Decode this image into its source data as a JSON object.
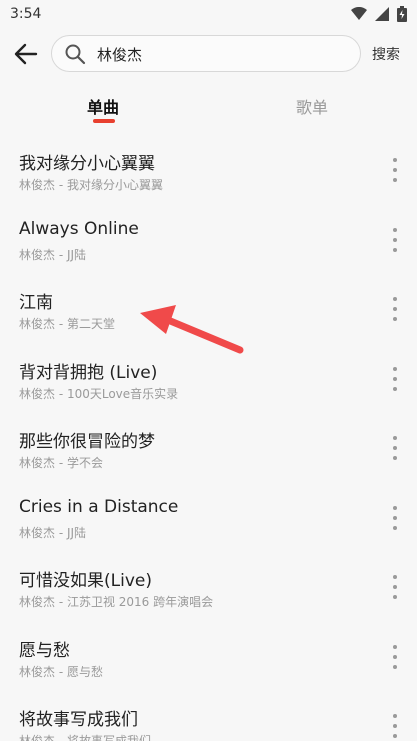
{
  "status": {
    "time": "3:54",
    "icons": [
      "wifi-icon",
      "signal-icon",
      "battery-icon"
    ]
  },
  "search": {
    "query": "林俊杰",
    "search_label": "搜索"
  },
  "tabs": [
    {
      "label": "单曲",
      "active": true
    },
    {
      "label": "歌单",
      "active": false
    }
  ],
  "songs": [
    {
      "title": "我对缘分小心翼翼",
      "subtitle": "林俊杰 - 我对缘分小心翼翼"
    },
    {
      "title": "Always Online",
      "subtitle": "林俊杰 - JJ陆"
    },
    {
      "title": "江南",
      "subtitle": "林俊杰 - 第二天堂"
    },
    {
      "title": "背对背拥抱 (Live)",
      "subtitle": "林俊杰 - 100天Love音乐实录"
    },
    {
      "title": "那些你很冒险的梦",
      "subtitle": "林俊杰 - 学不会"
    },
    {
      "title": "Cries in a Distance",
      "subtitle": "林俊杰 - JJ陆"
    },
    {
      "title": "可惜没如果(Live)",
      "subtitle": "林俊杰 - 江苏卫视 2016 跨年演唱会"
    },
    {
      "title": "愿与愁",
      "subtitle": "林俊杰 - 愿与愁"
    },
    {
      "title": "将故事写成我们",
      "subtitle": "林俊杰 - 将故事写成我们"
    }
  ],
  "colors": {
    "accent": "#e8402f",
    "arrow": "#f04a4a"
  }
}
